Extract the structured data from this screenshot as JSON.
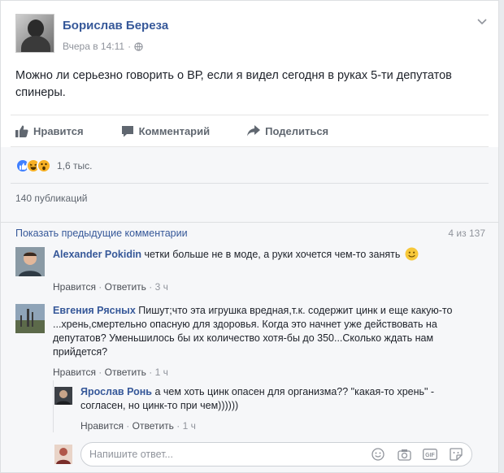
{
  "post": {
    "author": "Борислав Береза",
    "time": "Вчера в 14:11",
    "privacy_sep": "·",
    "text": "Можно ли серьезно говорить о ВР, если я видел сегодня в руках 5-ти депутатов спинеры."
  },
  "actions": {
    "like": "Нравится",
    "comment": "Комментарий",
    "share": "Поделиться"
  },
  "reactions": {
    "count": "1,6 тыс.",
    "icons": [
      "like-icon",
      "haha-icon",
      "wow-icon"
    ]
  },
  "shares": "140 публикаций",
  "comments": {
    "show_previous": "Показать предыдущие комментарии",
    "counter": "4 из 137",
    "items": [
      {
        "name": "Alexander Pokidin",
        "text": "четки больше не в моде, а руки хочется чем-то занять",
        "like": "Нравится",
        "reply": "Ответить",
        "sep": "·",
        "time": "3 ч"
      },
      {
        "name": "Евгения Рясных",
        "text": "Пишут;что эта игрушка вредная,т.к. содержит цинк и еще какую-то ...хрень,смертельно опасную для здоровья. Когда это начнет уже действовать на депутатов? Уменьшилось бы их количество хотя-бы до 350...Сколько ждать нам прийдется?",
        "like": "Нравится",
        "reply": "Ответить",
        "sep": "·",
        "time": "1 ч"
      }
    ],
    "reply": {
      "name": "Ярослав Ронь",
      "text": "а чем хоть цинк опасен для организма?? \"какая-то хрень\" - согласен, но цинк-то при чем))))))",
      "like": "Нравится",
      "reply": "Ответить",
      "sep": "·",
      "time": "1 ч"
    },
    "input_placeholder": "Напишите ответ..."
  },
  "colors": {
    "link": "#365899",
    "like_blue": "#4080ff",
    "muted": "#90949c",
    "bg": "#f6f7f9"
  }
}
